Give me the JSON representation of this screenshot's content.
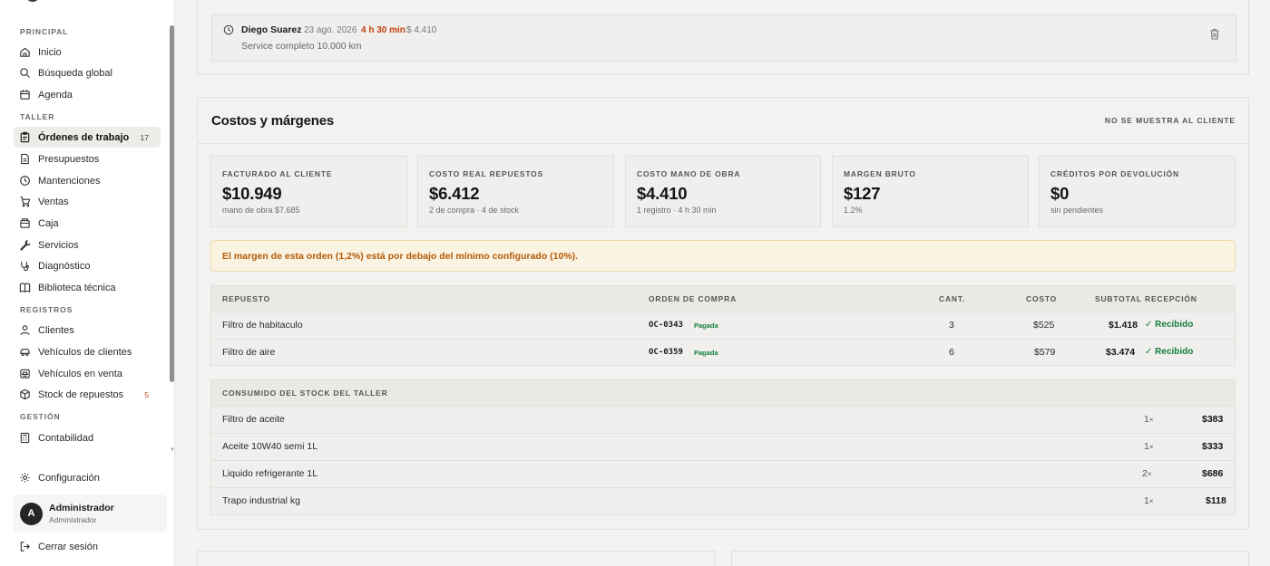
{
  "sidebar": {
    "sections": {
      "principal": "PRINCIPAL",
      "taller": "TALLER",
      "registros": "REGISTROS",
      "gestion": "GESTIÓN"
    },
    "items": [
      {
        "label": "Inicio",
        "icon": "home-icon"
      },
      {
        "label": "Búsqueda global",
        "icon": "search-icon"
      },
      {
        "label": "Agenda",
        "icon": "calendar-icon"
      },
      {
        "label": "Órdenes de trabajo",
        "icon": "clipboard-icon",
        "count": "17",
        "active": true
      },
      {
        "label": "Presupuestos",
        "icon": "document-icon"
      },
      {
        "label": "Mantenciones",
        "icon": "clock-icon"
      },
      {
        "label": "Ventas",
        "icon": "cart-icon"
      },
      {
        "label": "Caja",
        "icon": "cash-box-icon"
      },
      {
        "label": "Servicios",
        "icon": "wrench-icon"
      },
      {
        "label": "Diagnóstico",
        "icon": "stethoscope-icon"
      },
      {
        "label": "Biblioteca técnica",
        "icon": "book-icon"
      },
      {
        "label": "Clientes",
        "icon": "user-icon"
      },
      {
        "label": "Vehículos de clientes",
        "icon": "car-icon"
      },
      {
        "label": "Vehículos en venta",
        "icon": "car-tag-icon"
      },
      {
        "label": "Stock de repuestos",
        "icon": "package-icon",
        "count": "5"
      },
      {
        "label": "Contabilidad",
        "icon": "calculator-icon"
      }
    ],
    "settings_label": "Configuración",
    "user": {
      "initial": "A",
      "name": "Administrador",
      "role": "Administrador"
    },
    "logout_label": "Cerrar sesión"
  },
  "labor_entry": {
    "name": "Diego Suarez",
    "date": "23 ago. 2026",
    "duration": "4 h 30 min",
    "amount": "$ 4.410",
    "description": "Service completo 10.000 km"
  },
  "costs": {
    "title": "Costos y márgenes",
    "note": "NO SE MUESTRA AL CLIENTE",
    "stats": [
      {
        "label": "FACTURADO AL CLIENTE",
        "value": "$10.949",
        "sub": "mano de obra $7.685"
      },
      {
        "label": "COSTO REAL REPUESTOS",
        "value": "$6.412",
        "sub": "2 de compra · 4 de stock"
      },
      {
        "label": "COSTO MANO DE OBRA",
        "value": "$4.410",
        "sub": "1 registro · 4 h 30 min"
      },
      {
        "label": "MARGEN BRUTO",
        "value": "$127",
        "sub": "1.2%"
      },
      {
        "label": "CRÉDITOS POR DEVOLUCIÓN",
        "value": "$0",
        "sub": "sin pendientes"
      }
    ],
    "alert": "El margen de esta orden (1,2%) está por debajo del mínimo configurado (10%).",
    "purchase_table": {
      "headers": {
        "part": "REPUESTO",
        "po": "ORDEN DE COMPRA",
        "qty": "CANT.",
        "cost": "COSTO",
        "subtotal": "SUBTOTAL",
        "reception": "RECEPCIÓN"
      },
      "rows": [
        {
          "part": "Filtro de habitaculo",
          "po": "OC-0343",
          "status": "Pagada",
          "qty": "3",
          "cost": "$525",
          "subtotal": "$1.418",
          "reception": "✓ Recibido"
        },
        {
          "part": "Filtro de aire",
          "po": "OC-0359",
          "status": "Pagada",
          "qty": "6",
          "cost": "$579",
          "subtotal": "$3.474",
          "reception": "✓ Recibido"
        }
      ]
    },
    "stock_table": {
      "header": "CONSUMIDO DEL STOCK DEL TALLER",
      "rows": [
        {
          "part": "Filtro de aceite",
          "qty": "1",
          "unit": "×",
          "total": "$383"
        },
        {
          "part": "Aceite 10W40 semi 1L",
          "qty": "1",
          "unit": "×",
          "total": "$333"
        },
        {
          "part": "Liquido refrigerante 1L",
          "qty": "2",
          "unit": "×",
          "total": "$686"
        },
        {
          "part": "Trapo industrial kg",
          "qty": "1",
          "unit": "×",
          "total": "$118"
        }
      ]
    }
  }
}
